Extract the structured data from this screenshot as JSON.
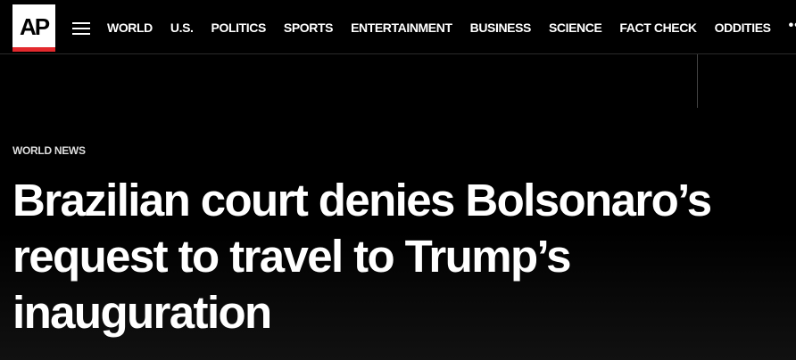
{
  "header": {
    "logo_text": "AP",
    "menu_icon": "hamburger-menu-icon",
    "nav": [
      "WORLD",
      "U.S.",
      "POLITICS",
      "SPORTS",
      "ENTERTAINMENT",
      "BUSINESS",
      "SCIENCE",
      "FACT CHECK",
      "ODDITIES"
    ],
    "more_label": "•••",
    "more_icon": "more-dots-icon"
  },
  "article": {
    "kicker": "WORLD NEWS",
    "headline": "Brazilian court denies Bolsonaro’s request to travel to Trump’s inauguration"
  },
  "colors": {
    "background": "#000000",
    "text": "#ffffff",
    "logo_accent": "#e3292d"
  }
}
